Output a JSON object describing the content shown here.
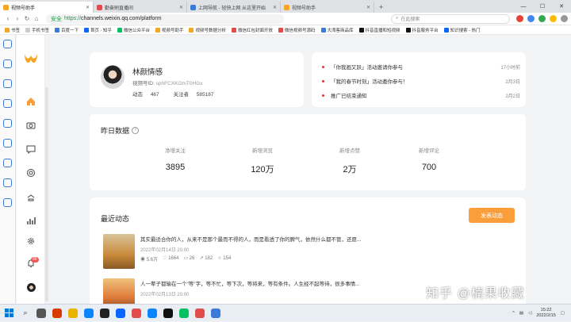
{
  "browser": {
    "tabs": [
      {
        "label": "视频号助手",
        "active": true
      },
      {
        "label": "勤奋刷直播间",
        "active": false
      },
      {
        "label": "上网导航 - 轻快上网 从这里开始",
        "active": false
      },
      {
        "label": "视频号助手",
        "active": false
      }
    ],
    "url_secure_label": "安全",
    "url_protocol": "https://",
    "url_host": "channels.weixin.qq.com/platform",
    "search_placeholder": "在此搜索",
    "bookmarks": [
      "书签",
      "手机书签",
      "百度一下",
      "首页 - 知乎",
      "微信公众平台",
      "视频号助手",
      "视频号数据分析",
      "微信红包封面开放",
      "微信视频号源码",
      "大湾客商品库",
      "抖音直播和短视频",
      "抖音服务平台",
      "知识搜索 - 热门"
    ]
  },
  "brand": {
    "accent": "#fa9d3b",
    "logo_color": "#f5a623"
  },
  "sidebar": {
    "items": [
      {
        "icon": "home-icon",
        "active": true
      },
      {
        "icon": "camera-icon"
      },
      {
        "icon": "message-icon"
      },
      {
        "icon": "live-icon"
      },
      {
        "icon": "gift-icon"
      },
      {
        "icon": "chart-icon"
      },
      {
        "icon": "settings-icon"
      },
      {
        "icon": "bell-icon"
      },
      {
        "icon": "avatar-icon"
      }
    ],
    "notification_count": "80"
  },
  "profile": {
    "name": "林颜情感",
    "id_label": "视频号ID:",
    "id_value": "sphFCXKOmT0HGx",
    "posts_label": "动态",
    "posts_value": "467",
    "followers_label": "关注者",
    "followers_value": "585187"
  },
  "notices": [
    {
      "text": "「你我画又跃」活动邀请你参与",
      "time": "17小时前"
    },
    {
      "text": "「我的春节时刻」活动邀你参与！",
      "time": "2月3日"
    },
    {
      "text": "推广已结束通知",
      "time": "2月2日"
    }
  ],
  "yesterday": {
    "title": "昨日数据",
    "stats": [
      {
        "label": "净增关注",
        "value": "3895"
      },
      {
        "label": "新增浏览",
        "value": "120万"
      },
      {
        "label": "新增点赞",
        "value": "2万"
      },
      {
        "label": "新增评论",
        "value": "700"
      }
    ]
  },
  "recent": {
    "title": "最近动态",
    "publish_label": "发表动态",
    "posts": [
      {
        "text": "其实最适合你的人，从来不是那个最而不得的人，而是看透了你的脾气，依然什么都不管，还愿...",
        "date": "2022年02月14日 20:00",
        "views": "5.6万",
        "likes": "1664",
        "comments": "26",
        "shares": "182",
        "favs": "154"
      },
      {
        "text": "人一辈子都输在一个\"等\"字，等不忙，等下次，等将来，等有条件。人生经不起等待，很多事情...",
        "date": "2022年02月13日 20:00",
        "views": "",
        "likes": "",
        "comments": "",
        "shares": "",
        "favs": ""
      }
    ]
  },
  "watermark": "知乎 @楠果收藏",
  "taskbar": {
    "time": "15:22",
    "date": "2022/2/15"
  }
}
